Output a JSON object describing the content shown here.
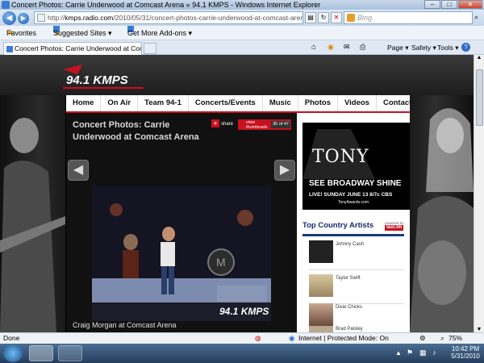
{
  "window": {
    "title": "Concert Photos: Carrie Underwood at Comcast Arena « 94.1 KMPS - Windows Internet Explorer"
  },
  "toolbar": {
    "address_prefix": "http://",
    "address_domain": "kmps.radio.com",
    "address_path": "/2010/05/31/concert-photos-carrie-underwood-at-comcast-arena/#photo-",
    "search_placeholder": "Bing"
  },
  "favbar": {
    "favorites_label": "Favorites",
    "suggested_label": "Suggested Sites ▾",
    "addons_label": "Get More Add-ons ▾"
  },
  "tab": {
    "label": "Concert Photos: Carrie Underwood at Comcast A..."
  },
  "commandbar": {
    "page_label": "Page ▾",
    "safety_label": "Safety ▾",
    "tools_label": "Tools ▾"
  },
  "site": {
    "logo_text": "94.1 KMPS",
    "nav": [
      "Home",
      "On Air",
      "Team 94-1",
      "Concerts/Events",
      "Music",
      "Photos",
      "Videos",
      "Contact"
    ]
  },
  "gallery": {
    "title": "Concert Photos: Carrie Underwood at Comcast Arena",
    "share_label": "share",
    "thumbnails_label": "view thumbnails",
    "counter": "35 of 47",
    "caption": "Craig Morgan at Comcast Arena",
    "prev_icon": "left-arrow-icon",
    "next_icon": "right-arrow-icon"
  },
  "ad": {
    "brand": "TONY",
    "line1": "SEE BROADWAY SHINE",
    "line2": "LIVE! SUNDAY JUNE 13 8/7c CBS",
    "url": "TonyAwards.com"
  },
  "artists": {
    "heading": "Top Country Artists",
    "powered_by": "powered by",
    "powered_brand": "last.fm",
    "items": [
      "Johnny Cash",
      "Taylor Swift",
      "Dixie Chicks",
      "Brad Paisley"
    ]
  },
  "status": {
    "left": "Done",
    "zone": "Internet | Protected Mode: On",
    "zoom": "75%"
  },
  "taskbar": {
    "time": "10:42 PM",
    "date": "5/31/2010"
  },
  "colors": {
    "accent_red": "#c8101e",
    "heading_blue": "#1a2a6e"
  }
}
